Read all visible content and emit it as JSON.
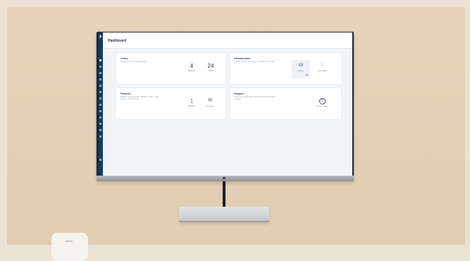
{
  "app": {
    "page_title": "Dashboard",
    "sidebar_logo": "▮"
  },
  "cards": {
    "cases": {
      "title": "Cases",
      "description": "Manage your system cases together",
      "stats": [
        {
          "value": "4",
          "label": "Requests"
        },
        {
          "value": "24",
          "label": "Active"
        }
      ]
    },
    "infrastructure": {
      "title": "Infrastructure",
      "description": "Register your devices and keep your software up to date",
      "actions": [
        {
          "icon": "network-icon",
          "glyph": "⛁",
          "label": "Add item"
        },
        {
          "icon": "arrow-up-icon",
          "glyph": "↑",
          "label": "Check updates"
        }
      ]
    },
    "partners": {
      "title": "Partners",
      "description": "Browse requests and invite partners to create or work together on shared cases",
      "stat": {
        "value": "1",
        "label": "Requests"
      },
      "action": {
        "icon": "envelope-icon",
        "glyph": "✉",
        "label": "Invite partner"
      }
    },
    "support": {
      "title": "Support",
      "description": "Create new support tickets and find help for all information you need",
      "action": {
        "icon": "question-icon",
        "glyph": "?",
        "label": "Request support"
      }
    }
  },
  "colors": {
    "sidebar": "#133a63",
    "background": "#f2f5f8",
    "accent": "#1f3a5c"
  }
}
